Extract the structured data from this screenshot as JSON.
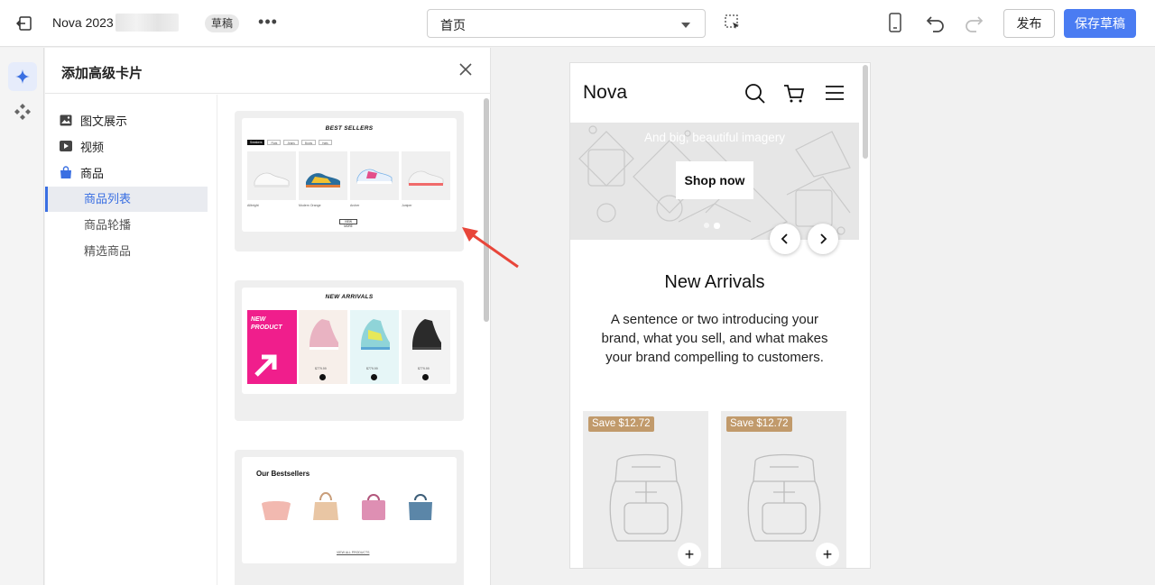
{
  "topbar": {
    "store_name": "Nova 2023",
    "status_badge": "草稿",
    "more": "•••",
    "page_select": "首页",
    "publish_label": "发布",
    "save_draft_label": "保存草稿"
  },
  "panel": {
    "title": "添加高级卡片",
    "categories": [
      {
        "label": "图文展示",
        "icon": "image-icon"
      },
      {
        "label": "视频",
        "icon": "video-play-icon"
      },
      {
        "label": "商品",
        "icon": "shopping-bag-icon"
      }
    ],
    "subcategories": [
      {
        "label": "商品列表",
        "active": true
      },
      {
        "label": "商品轮播",
        "active": false
      },
      {
        "label": "精选商品",
        "active": false
      }
    ],
    "cards": [
      {
        "title": "BEST SELLERS",
        "tabs": [
          "Sneakers",
          "Flats",
          "Jeans",
          "Boots",
          "Hats"
        ],
        "products": [
          "Allbright",
          "Modern Orange",
          "Archer",
          "Juniper"
        ],
        "button": "VIEW MORE"
      },
      {
        "title": "NEW ARRIVALS",
        "promo": "NEW PRODUCT",
        "prices": [
          "$779.99",
          "$779.99",
          "$779.99"
        ]
      },
      {
        "title": "Our Bestsellers",
        "link": "VIEW ALL PRODUCTS"
      }
    ]
  },
  "preview": {
    "logo": "Nova",
    "hero_text": "And big, beautiful imagery",
    "shop_button": "Shop now",
    "heading": "New Arrivals",
    "paragraph": "A sentence or two introducing your brand, what you sell, and what makes your brand compelling to customers.",
    "products": [
      {
        "badge": "Save $12.72"
      },
      {
        "badge": "Save $12.72"
      }
    ]
  },
  "colors": {
    "accent": "#4a7cf2",
    "active_nav": "#3a6fe2",
    "badge_tan": "#c19a6b",
    "promo_pink": "#f01e8c",
    "annotation_red": "#e8463a"
  }
}
